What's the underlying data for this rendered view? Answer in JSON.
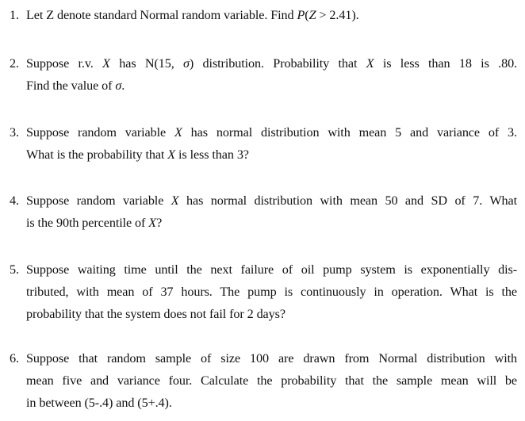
{
  "document": {
    "problems": [
      {
        "number": "1.",
        "lines": [
          [
            "Let Z denote standard Normal random variable. Find ",
            {
              "math": "P"
            },
            "(",
            {
              "math": "Z"
            },
            " > 2.41)."
          ]
        ],
        "text": "Let Z denote standard Normal random variable. Find P(Z > 2.41)."
      },
      {
        "number": "2.",
        "text": "Suppose r.v. X has N(15, σ) distribution. Probability that X is less than 18 is .80. Find the value of σ.",
        "line1": {
          "a": "Suppose r.v. ",
          "b": "X",
          "c": " has N(15, ",
          "d": "σ",
          "e": ") distribution. Probability that ",
          "f": "X",
          "g": " is less than 18 is .80."
        },
        "line2": {
          "a": "Find the value of ",
          "b": "σ",
          "c": "."
        }
      },
      {
        "number": "3.",
        "text": "Suppose random variable X has normal distribution with mean 5 and variance of 3. What is the probability that X is less than 3?",
        "line1": {
          "a": "Suppose random variable ",
          "b": "X",
          "c": " has normal distribution with mean 5 and variance of 3."
        },
        "line2": {
          "a": "What is the probability that ",
          "b": "X",
          "c": " is less than 3?"
        }
      },
      {
        "number": "4.",
        "text": "Suppose random variable X has normal distribution with mean 50 and SD of 7. What is the 90th percentile of X?",
        "line1": {
          "a": "Suppose random variable ",
          "b": "X",
          "c": " has normal distribution with mean 50 and SD of 7. What"
        },
        "line2": {
          "a": "is the 90th percentile of ",
          "b": "X",
          "c": "?"
        }
      },
      {
        "number": "5.",
        "text": "Suppose waiting time until the next failure of oil pump system is exponentially distributed, with mean of 37 hours. The pump is continuously in operation. What is the probability that the system does not fail for 2 days?",
        "line1": "Suppose waiting time until the next failure of oil pump system is exponentially dis-",
        "line2": "tributed, with mean of 37 hours. The pump is continuously in operation. What is the",
        "line3": "probability that the system does not fail for 2 days?"
      },
      {
        "number": "6.",
        "text": "Suppose that random sample of size 100 are drawn from Normal distribution with mean five and variance four. Calculate the probability that the sample mean will be in between (5-.4) and (5+.4).",
        "line1": "Suppose that random sample of size 100 are drawn from Normal distribution with",
        "line2": "mean five and variance four. Calculate the probability that the sample mean will be",
        "line3": "in between (5-.4) and (5+.4)."
      }
    ],
    "p1": {
      "a": "Let Z denote standard Normal random variable. Find ",
      "b": "P",
      "c": "(",
      "d": "Z",
      "e": " > 2.41)."
    }
  }
}
